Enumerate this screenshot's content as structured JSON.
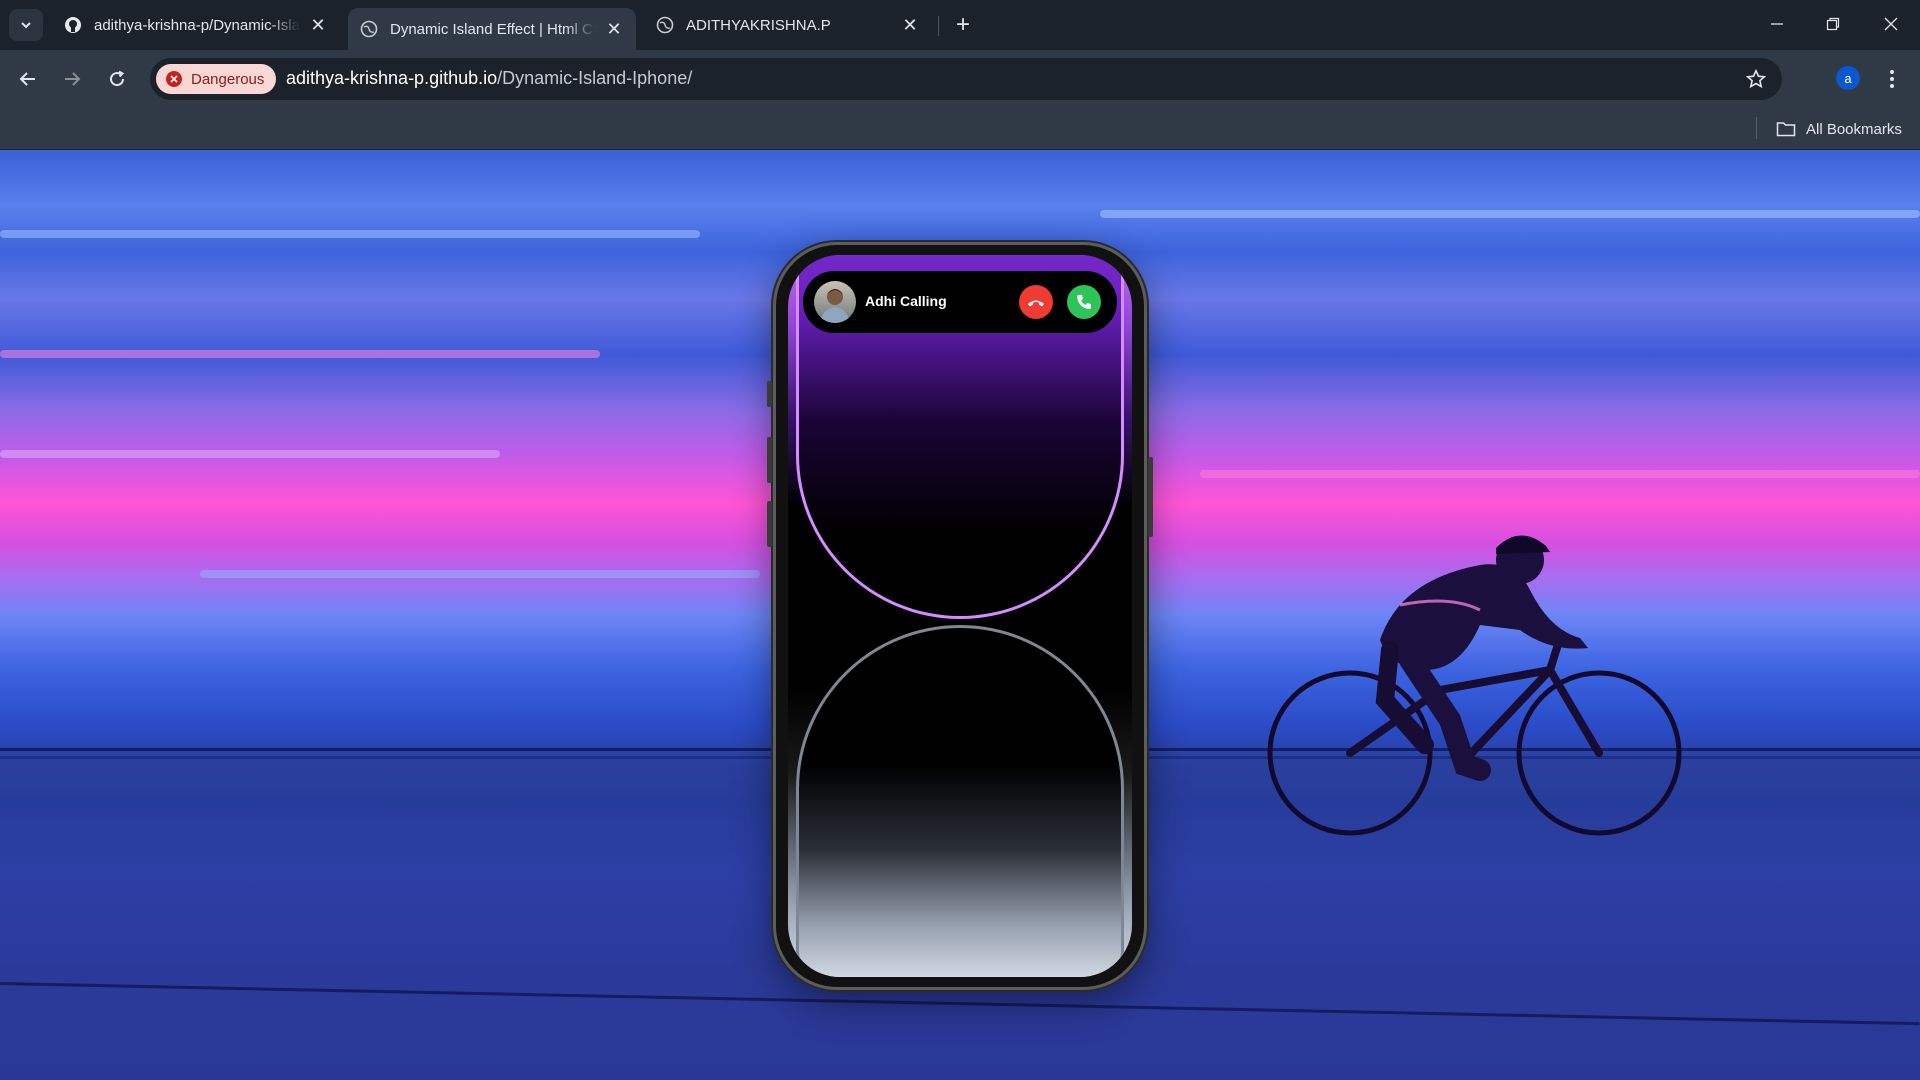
{
  "browser": {
    "tabs": [
      {
        "title": "adithya-krishna-p/Dynamic-Isla",
        "icon": "github-icon",
        "active": false
      },
      {
        "title": "Dynamic Island Effect | Html CSS",
        "icon": "globe-icon",
        "active": true
      },
      {
        "title": "ADITHYAKRISHNA.P",
        "icon": "globe-icon",
        "active": false
      }
    ],
    "security_chip": "Dangerous",
    "url_host": "adithya-krishna-p.github.io",
    "url_path": "/Dynamic-Island-Iphone/",
    "profile_initial": "a",
    "bookmarks_label": "All Bookmarks"
  },
  "page": {
    "caller_name": "Adhi Calling",
    "decline_icon": "phone-hangup-icon",
    "accept_icon": "phone-icon"
  },
  "colors": {
    "decline": "#ef3b32",
    "accept": "#2fc45a",
    "danger": "#c5221f"
  }
}
